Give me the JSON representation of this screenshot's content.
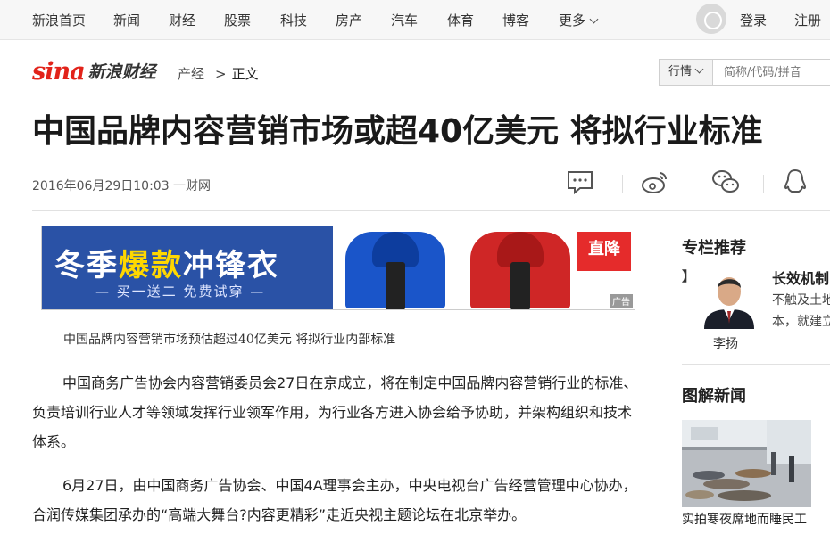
{
  "nav": {
    "items": [
      "新浪首页",
      "新闻",
      "财经",
      "股票",
      "科技",
      "房产",
      "汽车",
      "体育",
      "博客",
      "更多"
    ],
    "login": "登录",
    "register": "注册"
  },
  "logo": {
    "sina": "sina",
    "channel": "新浪财经"
  },
  "breadcrumb": {
    "section": "产经",
    "separator": ">",
    "current": "正文"
  },
  "search": {
    "select_label": "行情",
    "placeholder": "简称/代码/拼音"
  },
  "article": {
    "title": "中国品牌内容营销市场或超40亿美元 将拟行业标准",
    "meta": "2016年06月29日10:03 一财网",
    "ad": {
      "line1_a": "冬季",
      "line1_b": "爆款",
      "line1_c": "冲锋衣",
      "line2": "— 买一送二 免费试穿 —",
      "tag": "直降",
      "ad_label": "广告"
    },
    "caption": "中国品牌内容营销市场预估超过40亿美元 将拟行业内部标准",
    "paragraphs": [
      "中国商务广告协会内容营销委员会27日在京成立，将在制定中国品牌内容营销行业的标准、负责培训行业人才等领域发挥行业领军作用，为行业各方进入协会给予协助，并架构组织和技术体系。",
      "6月27日，由中国商务广告协会、中国4A理事会主办，中央电视台广告经营管理中心协办，合润传媒集团承办的“高端大舞台?内容更精彩”走近央视主题论坛在北京举办。"
    ]
  },
  "sidebar": {
    "column_title": "专栏推荐",
    "column": {
      "bracket": "】",
      "author": "李扬",
      "headline": "长效机制",
      "summary_1": "不触及土地",
      "summary_2": "本，就建立"
    },
    "news_title": "图解新闻",
    "news_caption": "实拍寒夜席地而睡民工"
  },
  "colors": {
    "brand_red": "#e2231a",
    "ad_blue": "#2a52a6",
    "ad_yellow": "#ffd800"
  }
}
